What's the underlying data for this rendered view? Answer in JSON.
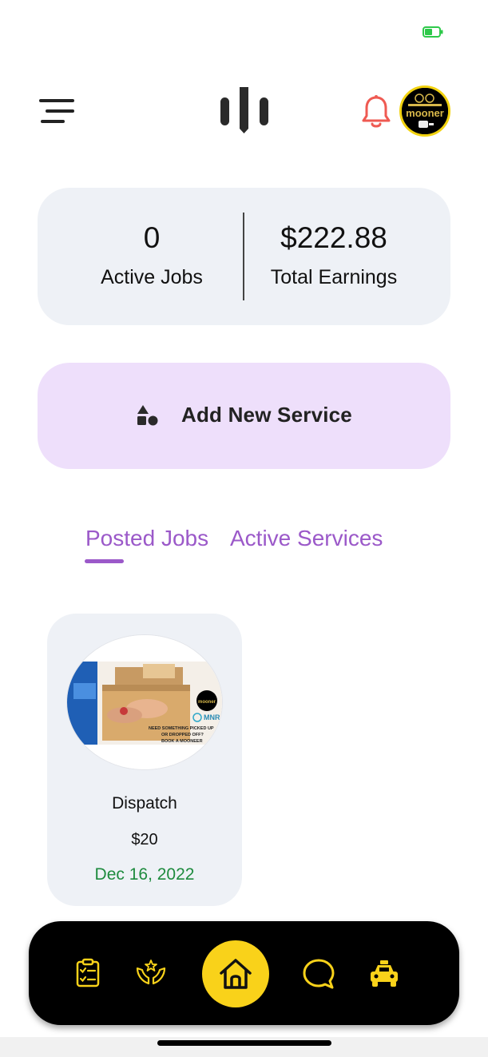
{
  "header": {
    "menu_icon": "hamburger-menu-icon",
    "logo_icon": "brand-bars-logo",
    "notification_icon": "bell-icon",
    "notification_color": "#ef5a52",
    "avatar_icon": "mooner-avatar"
  },
  "stats": {
    "active_jobs_value": "0",
    "active_jobs_label": "Active Jobs",
    "total_earnings_value": "$222.88",
    "total_earnings_label": "Total Earnings"
  },
  "add_service": {
    "label": "Add New Service",
    "icon": "shapes-icon",
    "background": "#eedffb"
  },
  "tabs": [
    {
      "label": "Posted Jobs",
      "selected": true
    },
    {
      "label": "Active Services",
      "selected": false
    }
  ],
  "jobs": [
    {
      "title": "Dispatch",
      "price": "$20",
      "date": "Dec 16, 2022",
      "image_icon": "delivery-boxes-photo",
      "image_text": [
        "NEED SOMETHING PICKED UP",
        "OR DROPPED OFF?",
        "BOOK A MOONEER",
        "MNR",
        "mooner"
      ]
    }
  ],
  "bottom_nav": {
    "items": [
      "clipboard-checklist-icon",
      "hands-star-icon",
      "home-icon",
      "chat-bubble-icon",
      "taxi-icon"
    ],
    "active": "home-icon",
    "accent": "#f9d21a"
  },
  "colors": {
    "accent_purple": "#9b59c9",
    "date_green": "#1e8b3e",
    "card_bg": "#eef1f6",
    "battery_green": "#2ec94a"
  }
}
